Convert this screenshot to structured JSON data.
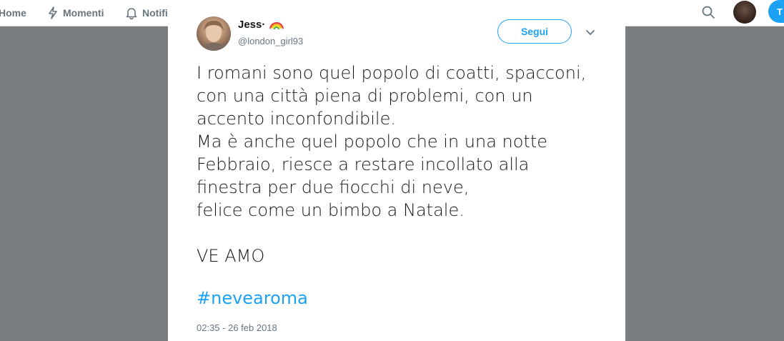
{
  "nav": {
    "items": [
      {
        "label": "Home",
        "icon": "home-icon"
      },
      {
        "label": "Momenti",
        "icon": "lightning-icon"
      },
      {
        "label": "Notifi",
        "icon": "bell-icon"
      }
    ],
    "search_icon": "search-icon",
    "tweet_button_label": "T"
  },
  "tweet": {
    "display_name": "Jess·",
    "emoji": "rainbow-icon",
    "handle": "@london_girl93",
    "follow_label": "Segui",
    "text": "I romani sono quel popolo di coatti, spacconi,\ncon una città piena di problemi, con un\naccento inconfondibile.\nMa è anche quel popolo che in  una notte\nFebbraio, riesce a restare incollato alla\nfinestra per due fiocchi di neve,\nfelice come un bimbo a Natale.\n\nVE AMO",
    "hashtag": "#nevearoma",
    "timestamp": "02:35 - 26 feb 2018"
  },
  "colors": {
    "accent": "#1da1f2",
    "overlay": "#7a7d80",
    "text": "#14171a",
    "muted": "#657786"
  }
}
